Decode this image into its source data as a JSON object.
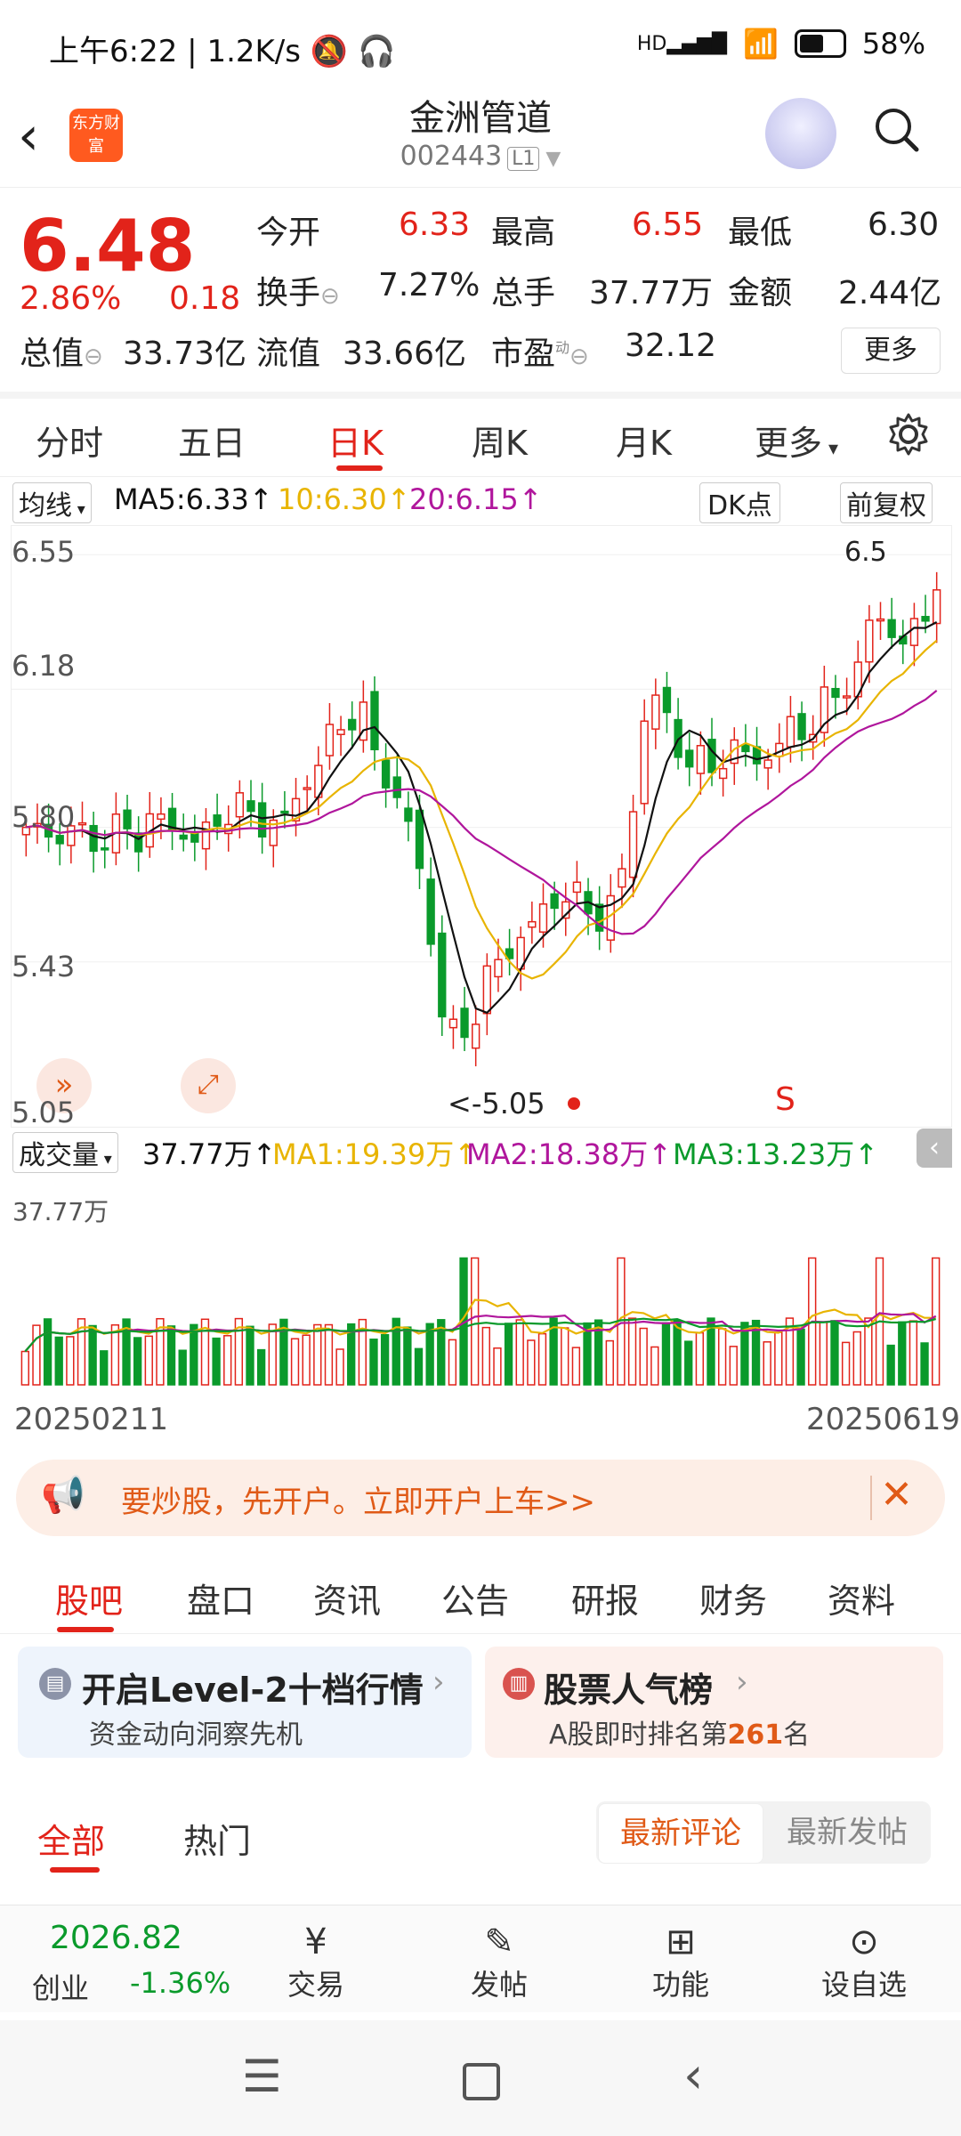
{
  "status": {
    "time": "上午6:22",
    "speed": "1.2K/s",
    "network": "HD",
    "battery": "58%"
  },
  "header": {
    "back_icon": "chevron-left-icon",
    "logo_text": "东方财富",
    "title": "金洲管道",
    "code": "002443",
    "level": "L1"
  },
  "quote": {
    "price": "6.48",
    "change_pct": "2.86%",
    "change": "0.18",
    "open_label": "今开",
    "open": "6.33",
    "high_label": "最高",
    "high": "6.55",
    "low_label": "最低",
    "low": "6.30",
    "turnover_label": "换手",
    "turnover": "7.27%",
    "vol_label": "总手",
    "vol": "37.77万",
    "amount_label": "金额",
    "amount": "2.44亿",
    "mcap_label": "总值",
    "mcap": "33.73亿",
    "float_label": "流值",
    "float": "33.66亿",
    "pe_label": "市盈",
    "pe_sup": "动",
    "pe": "32.12",
    "more": "更多"
  },
  "tabs": [
    "分时",
    "五日",
    "日K",
    "周K",
    "月K",
    "更多"
  ],
  "indicator": {
    "ma_label": "均线",
    "ma5": "MA5:6.33",
    "ma10": "10:6.30",
    "ma20": "20:6.15",
    "dk": "DK点",
    "fq": "前复权"
  },
  "chart_data": {
    "type": "candlestick",
    "yticks": [
      "6.55",
      "6.18",
      "5.80",
      "5.43",
      "5.05"
    ],
    "low_label": "<-5.05",
    "high_label": "6.5",
    "signal_label": "S",
    "x_start": "20250211",
    "x_end": "20250619",
    "volume": {
      "label": "成交量",
      "current": "37.77万",
      "ma1": "MA1:19.39万",
      "ma2": "MA2:18.38万",
      "ma3": "MA3:13.23万",
      "max_label": "37.77万"
    }
  },
  "colors": {
    "up": "#e2231a",
    "down": "#0a9a2b",
    "ma5": "#111111",
    "ma10": "#e8b400",
    "ma20": "#b0169c",
    "accent": "#e05a17"
  },
  "banner": {
    "text": "要炒股，先开户。立即开户上车>>"
  },
  "content_tabs": [
    "股吧",
    "盘口",
    "资讯",
    "公告",
    "研报",
    "财务",
    "资料"
  ],
  "cards": [
    {
      "title": "开启Level-2十档行情",
      "sub": "资金动向洞察先机"
    },
    {
      "title": "股票人气榜",
      "sub_prefix": "A股即时排名第",
      "rank": "261",
      "sub_suffix": "名"
    }
  ],
  "filter_tabs": [
    "全部",
    "热门"
  ],
  "sort_tabs": [
    "最新评论",
    "最新发帖"
  ],
  "bottom": {
    "index_value": "2026.82",
    "index_name": "创业",
    "index_change": "-1.36%",
    "items": [
      "交易",
      "发帖",
      "功能",
      "设自选"
    ]
  }
}
